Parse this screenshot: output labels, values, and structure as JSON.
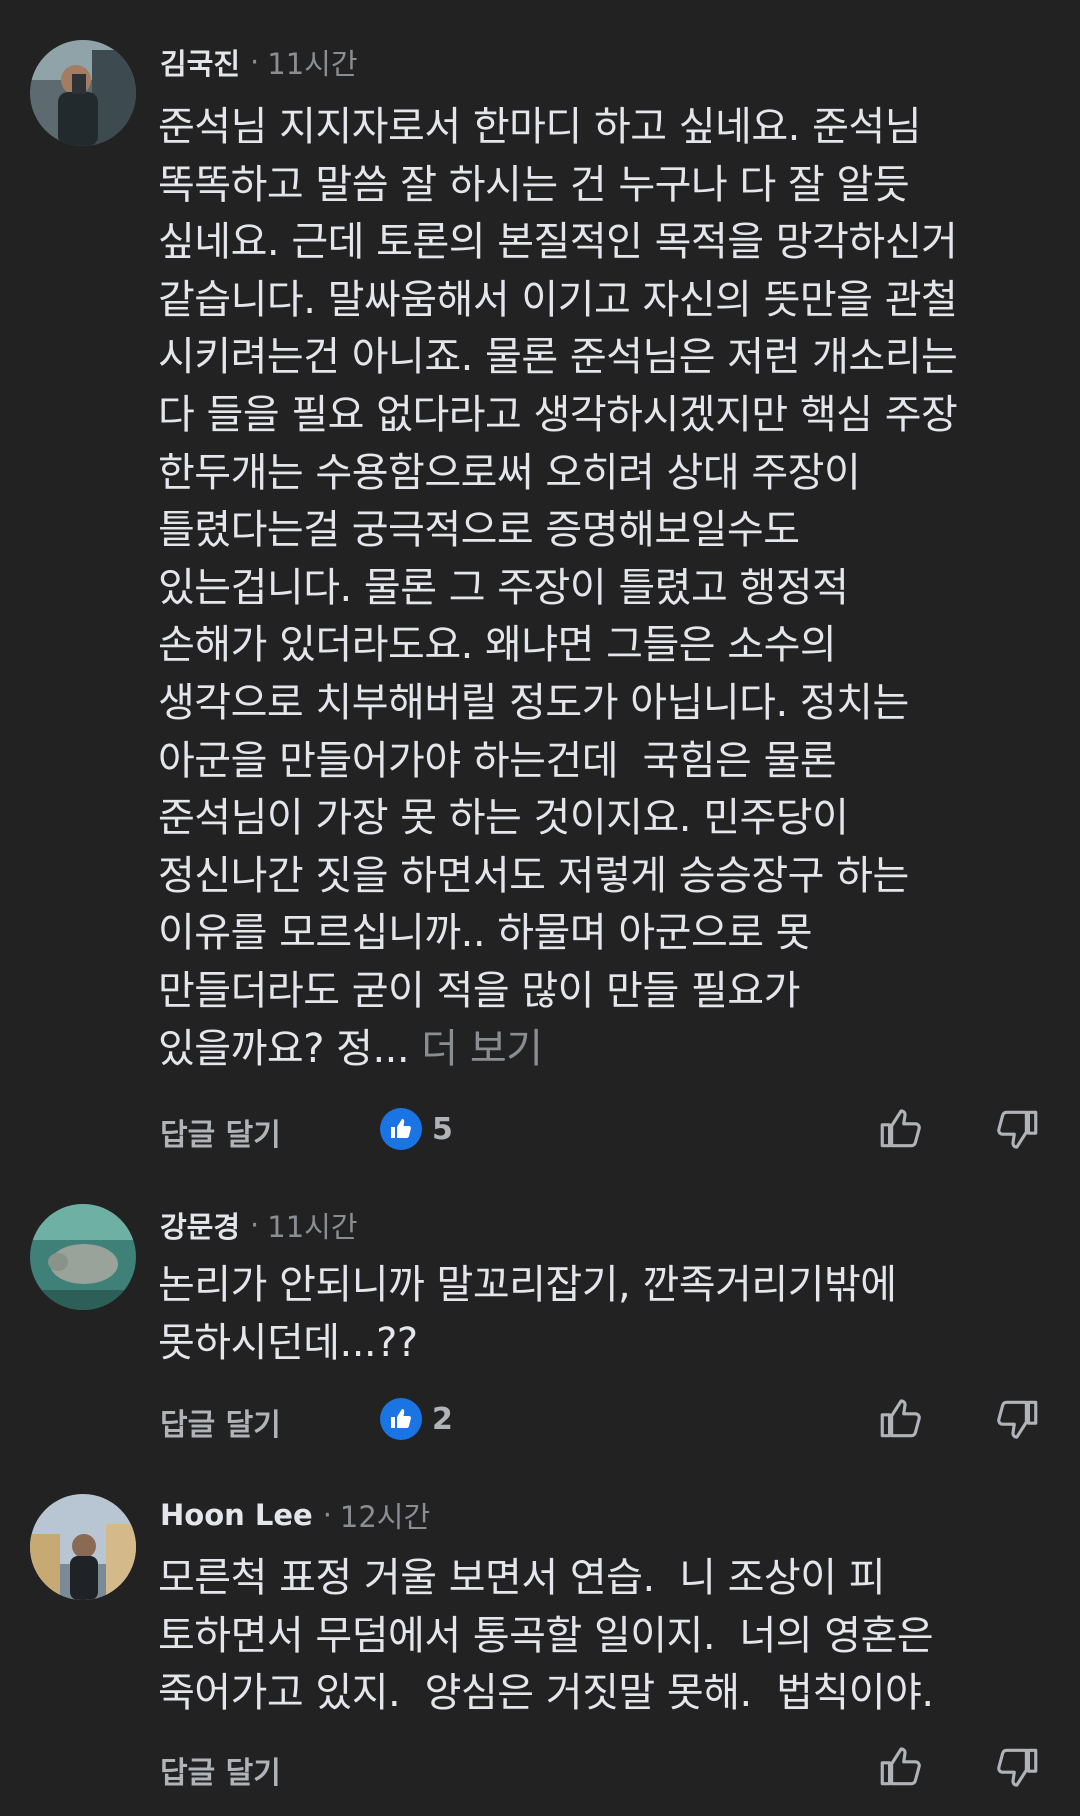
{
  "comments": [
    {
      "author": "김국진",
      "time": "11시간",
      "lines": [
        "준석님 지지자로서 한마디 하고 싶네요. 준석님",
        "똑똑하고 말씀 잘 하시는 건 누구나 다 잘 알듯",
        "싶네요. 근데 토론의 본질적인 목적을 망각하신거",
        "같습니다. 말싸움해서 이기고 자신의 뜻만을 관철",
        "시키려는건 아니죠. 물론 준석님은 저런 개소리는",
        "다 들을 필요 없다라고 생각하시겠지만 핵심 주장",
        "한두개는 수용함으로써 오히려 상대 주장이",
        "틀렸다는걸 궁극적으로 증명해보일수도",
        "있는겁니다. 물론 그 주장이 틀렸고 행정적",
        "손해가 있더라도요. 왜냐면 그들은 소수의",
        "생각으로 치부해버릴 정도가 아닙니다. 정치는",
        "아군을 만들어가야 하는건데  국힘은 물론",
        "준석님이 가장 못 하는 것이지요. 민주당이",
        "정신나간 짓을 하면서도 저렇게 승승장구 하는",
        "이유를 모르십니까.. 하물며 아군으로 못",
        "만들더라도 굳이 적을 많이 만들 필요가",
        "있을까요? 정..."
      ],
      "more_label": " 더 보기",
      "reply_label": "답글 달기",
      "like_count": "5"
    },
    {
      "author": "강문경",
      "time": "11시간",
      "lines": [
        "논리가 안되니까 말꼬리잡기, 깐족거리기밖에",
        "못하시던데...??"
      ],
      "reply_label": "답글 달기",
      "like_count": "2"
    },
    {
      "author": "Hoon Lee",
      "time": "12시간",
      "lines": [
        "모른척 표정 거울 보면서 연습.  니 조상이 피",
        "토하면서 무덤에서 통곡할 일이지.  너의 영혼은",
        "죽어가고 있지.  양심은 거짓말 못해.  법칙이야."
      ],
      "reply_label": "답글 달기"
    }
  ],
  "icons": {
    "like_badge": "thumbs-up-icon",
    "upvote": "thumbs-up-outline-icon",
    "downvote": "thumbs-down-outline-icon"
  },
  "colors": {
    "background": "#222222",
    "text": "#e4e6eb",
    "muted": "#8a8d91",
    "like_blue": "#1b74e4"
  }
}
